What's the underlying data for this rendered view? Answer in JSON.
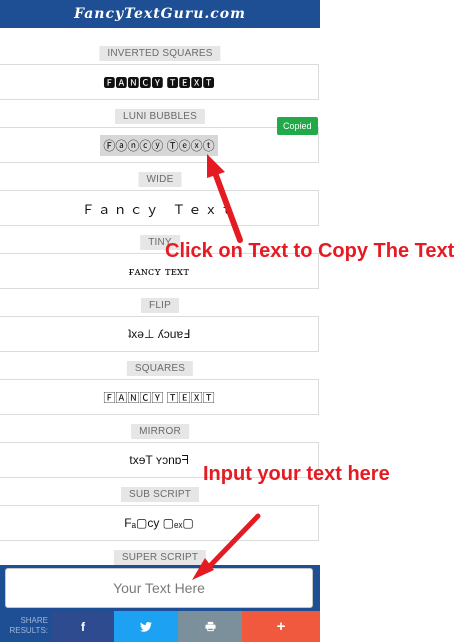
{
  "site": {
    "title": "FancyTextGuru.com"
  },
  "styles": [
    {
      "label": "INVERTED SQUARES",
      "text": "🅵🅰🅽🅲🆈 🆃🅴🆇🆃"
    },
    {
      "label": "LUNI BUBBLES",
      "text": "Ⓕⓐⓝⓒⓨ Ⓣⓔⓧⓣ"
    },
    {
      "label": "WIDE",
      "text": "Ｆａｎｃｙ Ｔｅｘｔ"
    },
    {
      "label": "TINY",
      "text": "ғᴀɴᴄʏ ᴛᴇxᴛ"
    },
    {
      "label": "FLIP",
      "text": "ʇxǝ⊥ ʎɔuɐℲ"
    },
    {
      "label": "SQUARES",
      "text": "🄵🄰🄽🄲🅈 🅃🄴🅇🅃"
    },
    {
      "label": "MIRROR",
      "text": "txɘT ʏɔnɒᖷ"
    },
    {
      "label": "SUB SCRIPT",
      "text": "Fₐ▢cy ▢ₑₓ▢"
    },
    {
      "label": "SUPER SCRIPT",
      "text": ""
    }
  ],
  "copied_badge": "Copied",
  "callouts": {
    "copy": "Click on Text to Copy The Text",
    "input": "Input your text here"
  },
  "input": {
    "placeholder": "Your Text Here"
  },
  "share": {
    "label": "SHARE RESULTS:",
    "facebook": "f",
    "twitter": "🐦",
    "print": "🖶",
    "more": "+"
  },
  "colors": {
    "brand_blue": "#1e4f95",
    "copied_green": "#22a94a",
    "callout_red": "#e51b24"
  }
}
